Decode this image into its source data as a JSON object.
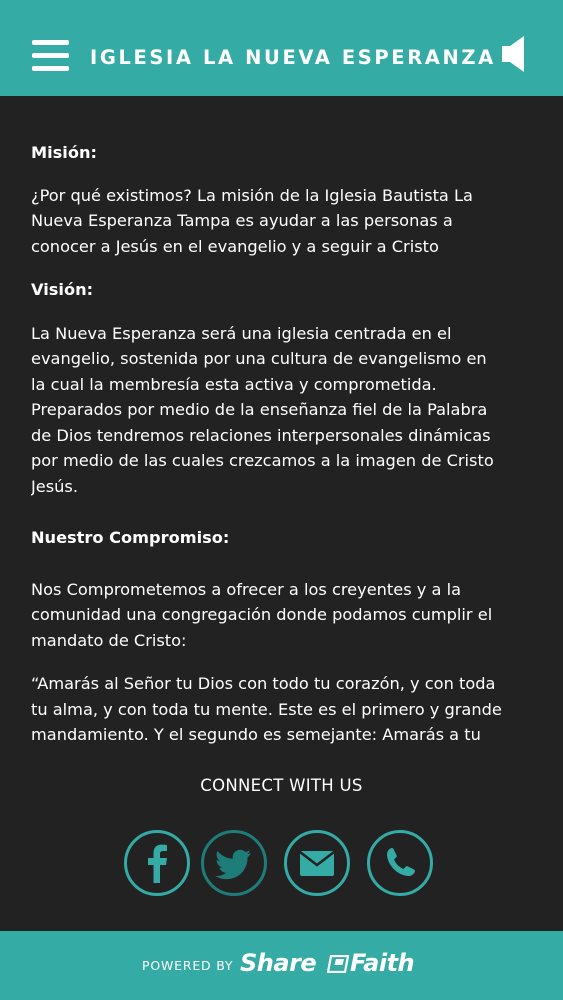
{
  "header": {
    "title": "IGLESIA LA NUEVA ESPERANZA",
    "menu_icon": "hamburger-menu-icon",
    "sound_icon": "speaker-icon"
  },
  "content": {
    "mision_heading": "Misión:",
    "mision_lines": [
      "¿Por qué existimos? La misión de la Iglesia Bautista La",
      "Nueva Esperanza Tampa es ayudar a las personas a",
      "conocer a Jesús en el evangelio y a seguir a Cristo"
    ],
    "vision_heading": "Visión:",
    "vision_lines": [
      "La Nueva Esperanza será una iglesia centrada en el",
      "evangelio, sostenida por una cultura de evangelismo en",
      "la cual la membresía esta activa y comprometida.",
      "Preparados por medio de la enseñanza fiel de la Palabra",
      "de Dios tendremos relaciones interpersonales dinámicas",
      "por medio de las cuales crezcamos a la imagen de Cristo",
      "Jesús."
    ],
    "compromiso_heading": "Nuestro Compromiso:",
    "compromiso_lines": [
      "Nos Comprometemos a ofrecer a los creyentes y a la",
      "comunidad una congregación donde podamos cumplir el",
      "mandato de Cristo:"
    ],
    "quote_lines": [
      "“Amarás al Señor tu Dios con todo tu corazón, y con toda",
      "tu alma, y con toda tu mente. Este es el primero y grande",
      "mandamiento. Y el segundo es semejante: Amarás a tu"
    ]
  },
  "connect": {
    "label": "CONNECT WITH US",
    "buttons": [
      "facebook-icon",
      "twitter-icon",
      "email-icon",
      "phone-icon"
    ]
  },
  "footer": {
    "powered_by": "POWERED BY",
    "brand_part1": "Share",
    "brand_part2": "Faith"
  },
  "colors": {
    "accent": "#35aba6",
    "background": "#232223",
    "text": "#ffffff"
  }
}
